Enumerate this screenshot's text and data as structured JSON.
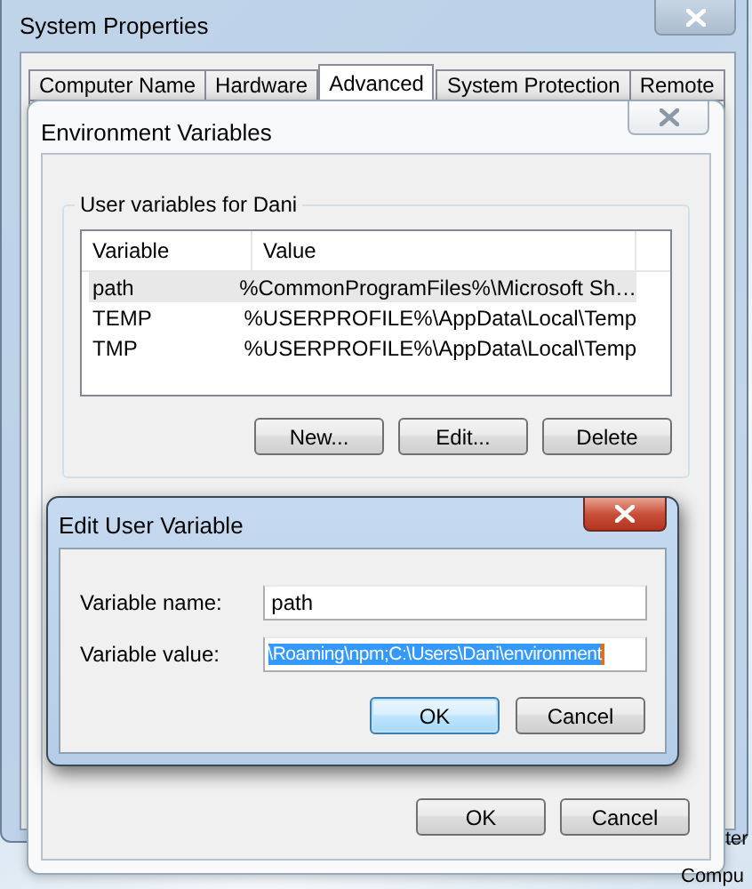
{
  "background_texts": [
    "ter",
    "Compu"
  ],
  "system_properties": {
    "title": "System Properties",
    "tabs": [
      {
        "label": "Computer Name",
        "selected": false
      },
      {
        "label": "Hardware",
        "selected": false
      },
      {
        "label": "Advanced",
        "selected": true
      },
      {
        "label": "System Protection",
        "selected": false
      },
      {
        "label": "Remote",
        "selected": false
      }
    ]
  },
  "environment_variables": {
    "title": "Environment Variables",
    "user_group": {
      "title": "User variables for Dani",
      "columns": [
        "Variable",
        "Value"
      ],
      "rows": [
        {
          "variable": "path",
          "value": "%CommonProgramFiles%\\Microsoft Sh…",
          "selected": true
        },
        {
          "variable": "TEMP",
          "value": "%USERPROFILE%\\AppData\\Local\\Temp",
          "selected": false
        },
        {
          "variable": "TMP",
          "value": "%USERPROFILE%\\AppData\\Local\\Temp",
          "selected": false
        }
      ],
      "buttons": [
        "New...",
        "Edit...",
        "Delete"
      ]
    },
    "buttons": [
      "OK",
      "Cancel"
    ]
  },
  "edit_dialog": {
    "title": "Edit User Variable",
    "fields": [
      {
        "label": "Variable name:",
        "value": "path",
        "selected": false
      },
      {
        "label": "Variable value:",
        "value": "\\Roaming\\npm;C:\\Users\\Dani\\environment",
        "selected": true
      }
    ],
    "buttons": [
      {
        "label": "OK",
        "default": true
      },
      {
        "label": "Cancel",
        "default": false
      }
    ]
  }
}
